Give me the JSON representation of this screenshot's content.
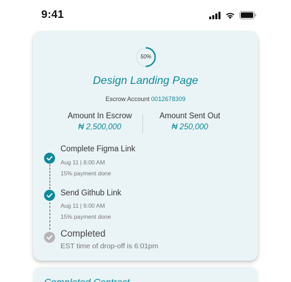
{
  "status_bar": {
    "time": "9:41",
    "signal_icon": "cellular-signal-icon",
    "wifi_icon": "wifi-icon",
    "battery_icon": "battery-icon"
  },
  "card": {
    "progress": {
      "label": "50%",
      "fraction": 0.5,
      "color": "#0d8a9a"
    },
    "title": "Design Landing Page",
    "escrow": {
      "label": "Escrow Account",
      "account_number": "0012678309"
    },
    "amounts": {
      "in_escrow": {
        "label": "Amount In Escrow",
        "value": "₦ 2,500,000"
      },
      "sent_out": {
        "label": "Amount Sent Out",
        "value": "₦ 250,000"
      }
    },
    "steps": [
      {
        "title": "Complete Figma Link",
        "date": "Aug 11 | 6:00 AM",
        "note": "15% payment done",
        "status": "done"
      },
      {
        "title": "Send Github Link",
        "date": "Aug 11 | 6:00 AM",
        "note": "15% payment done",
        "status": "done"
      },
      {
        "title": "Completed",
        "note": "EST time of drop-off is 6:01pm",
        "status": "pending"
      }
    ]
  },
  "bottom_card": {
    "title": "Completed Contract"
  },
  "colors": {
    "accent": "#0d8a9a",
    "card_bg": "#eaf4f6",
    "pending": "#b5b5b5"
  }
}
